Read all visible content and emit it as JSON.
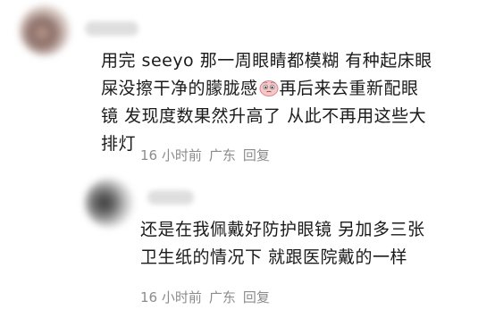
{
  "comments": [
    {
      "line1": "用完 seeyo 那一周眼睛都模糊 有种起床眼",
      "line2": "屎没擦干净的朦胧感",
      "line2b": "再后来去重新配眼",
      "line3": "镜 发现度数果然升高了 从此不再用这些大",
      "line4": "排灯",
      "emoji": "pleading-face-emoji",
      "time": "16 小时前",
      "location": "广东",
      "reply": "回复"
    },
    {
      "line1": "还是在我佩戴好防护眼镜 另加多三张",
      "line2": "卫生纸的情况下 就跟医院戴的一样",
      "time": "16 小时前",
      "location": "广东",
      "reply": "回复"
    }
  ]
}
